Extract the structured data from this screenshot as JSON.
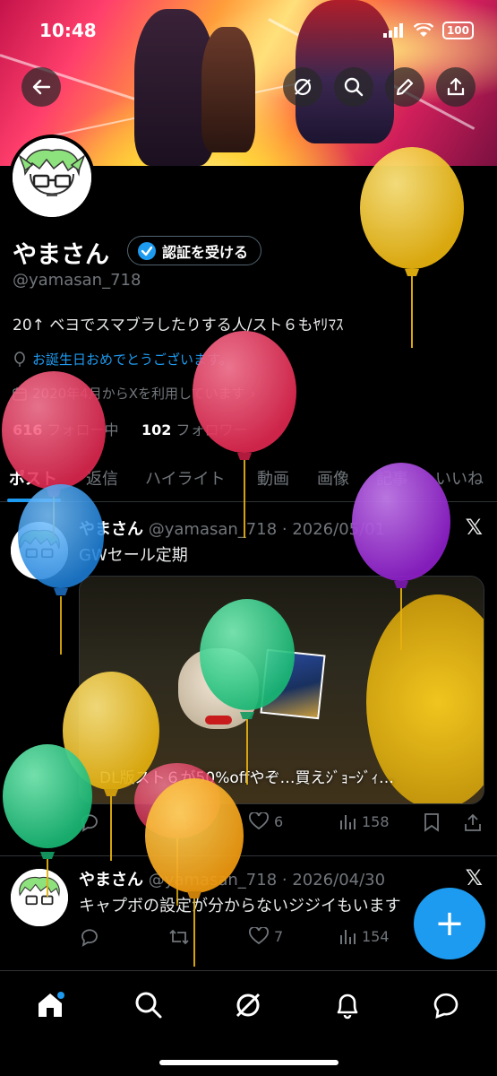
{
  "status_bar": {
    "time": "10:48",
    "battery": "100"
  },
  "profile": {
    "name": "やまさん",
    "verify_label": "認証を受ける",
    "handle": "@yamasan_718",
    "bio": "20↑ ベヨでスマブラしたりする人/スト６もﾔﾘﾏｽ",
    "birthday": "お誕生日おめでとうございます。",
    "joined": "2020年4月からXを利用しています",
    "following_count": "616",
    "following_label": "フォロー中",
    "followers_count": "102",
    "followers_label": "フォロワー"
  },
  "tabs": [
    "ポスト",
    "返信",
    "ハイライト",
    "動画",
    "画像",
    "記事",
    "いいね"
  ],
  "posts": [
    {
      "name": "やまさん",
      "meta": "@yamasan_718 · 2026/05/01",
      "text": "GWセール定期",
      "card_caption": "DL版スト６が50%offやぞ…買えｼﾞｮｰｼﾞｨ…",
      "likes": "6",
      "views": "158"
    },
    {
      "name": "やまさん",
      "meta": "@yamasan_718 · 2026/04/30",
      "text": "キャプボの設定が分からないジジイもいます",
      "likes": "7",
      "views": "154"
    }
  ],
  "colors": {
    "accent": "#1d9bf0",
    "background": "#000000",
    "muted": "#71767b"
  }
}
